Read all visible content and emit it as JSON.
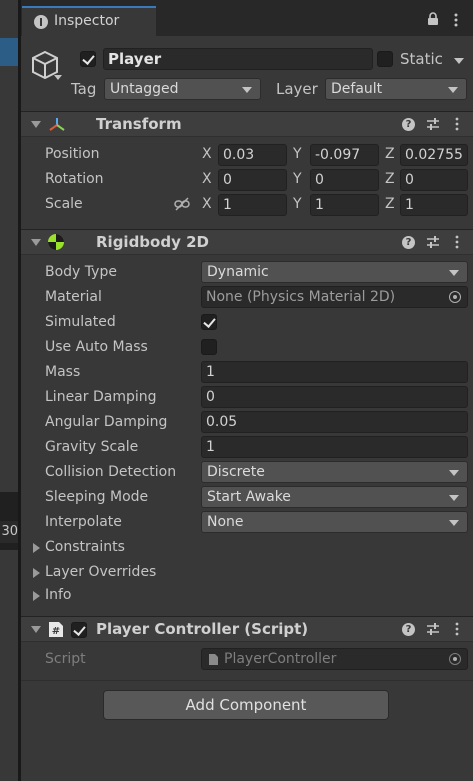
{
  "left_panel": {
    "partial_value": "30"
  },
  "tab": {
    "title": "Inspector",
    "icon": "info-icon"
  },
  "header": {
    "name": "Player",
    "active": true,
    "static_label": "Static",
    "static": false,
    "tag_label": "Tag",
    "tag_value": "Untagged",
    "layer_label": "Layer",
    "layer_value": "Default"
  },
  "transform": {
    "title": "Transform",
    "position": {
      "label": "Position",
      "x": "0.03",
      "y": "-0.097",
      "z": "0.02755"
    },
    "rotation": {
      "label": "Rotation",
      "x": "0",
      "y": "0",
      "z": "0"
    },
    "scale": {
      "label": "Scale",
      "x": "1",
      "y": "1",
      "z": "1"
    },
    "axis": {
      "x": "X",
      "y": "Y",
      "z": "Z"
    }
  },
  "rigidbody": {
    "title": "Rigidbody 2D",
    "body_type": {
      "label": "Body Type",
      "value": "Dynamic"
    },
    "material": {
      "label": "Material",
      "value": "None (Physics Material 2D)"
    },
    "simulated": {
      "label": "Simulated",
      "checked": true
    },
    "use_auto_mass": {
      "label": "Use Auto Mass",
      "checked": false
    },
    "mass": {
      "label": "Mass",
      "value": "1"
    },
    "linear_damping": {
      "label": "Linear Damping",
      "value": "0"
    },
    "angular_damping": {
      "label": "Angular Damping",
      "value": "0.05"
    },
    "gravity_scale": {
      "label": "Gravity Scale",
      "value": "1"
    },
    "collision_detection": {
      "label": "Collision Detection",
      "value": "Discrete"
    },
    "sleeping_mode": {
      "label": "Sleeping Mode",
      "value": "Start Awake"
    },
    "interpolate": {
      "label": "Interpolate",
      "value": "None"
    },
    "foldouts": [
      "Constraints",
      "Layer Overrides",
      "Info"
    ]
  },
  "player_controller": {
    "title": "Player Controller (Script)",
    "enabled": true,
    "script_label": "Script",
    "script_value": "PlayerController"
  },
  "add_component_label": "Add Component",
  "colors": {
    "accent": "#3a79bb",
    "panel": "#383838",
    "field": "#2a2a2a",
    "selection": "#2c5d87"
  }
}
